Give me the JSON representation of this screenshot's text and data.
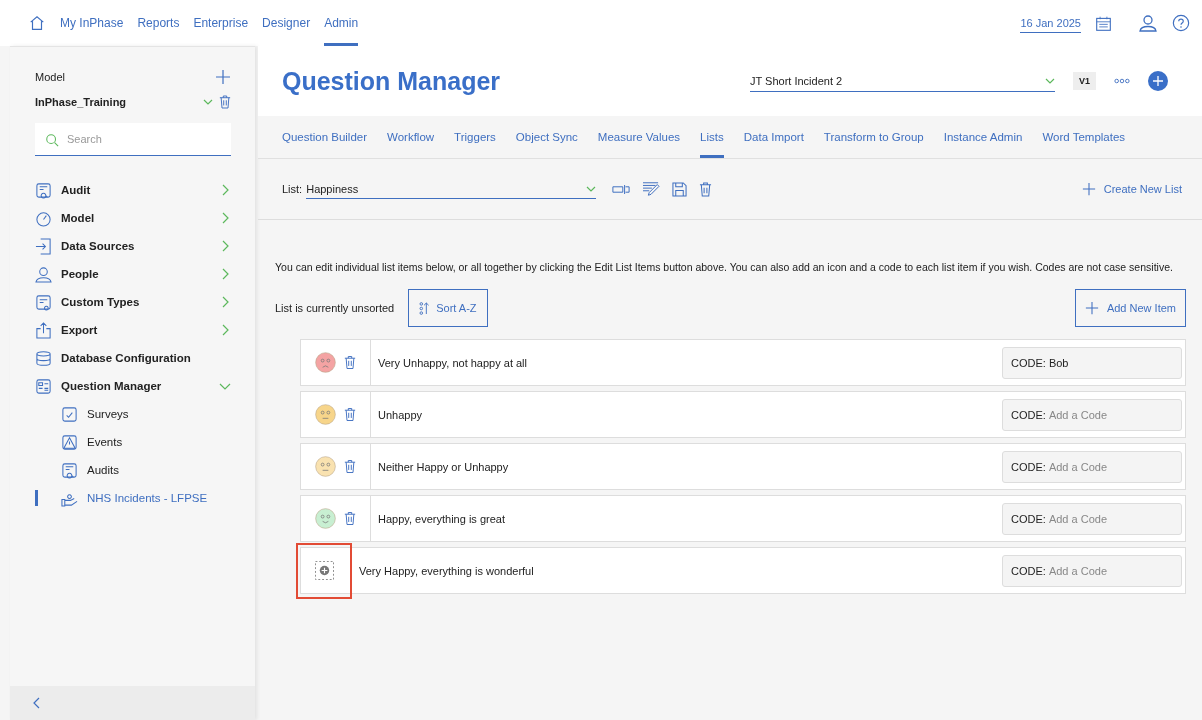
{
  "top_nav": {
    "items": [
      {
        "label": "My InPhase",
        "selected": false
      },
      {
        "label": "Reports",
        "selected": false
      },
      {
        "label": "Enterprise",
        "selected": false
      },
      {
        "label": "Designer",
        "selected": false
      },
      {
        "label": "Admin",
        "selected": true
      }
    ],
    "date": "16 Jan 2025"
  },
  "sidebar": {
    "model_label": "Model",
    "model_value": "InPhase_Training",
    "search": {
      "placeholder": "Search"
    },
    "items": [
      {
        "label": "Audit",
        "expanded": false
      },
      {
        "label": "Model",
        "expanded": false
      },
      {
        "label": "Data Sources",
        "expanded": false
      },
      {
        "label": "People",
        "expanded": false
      },
      {
        "label": "Custom Types",
        "expanded": false
      },
      {
        "label": "Export",
        "expanded": false
      },
      {
        "label": "Database Configuration"
      },
      {
        "label": "Question Manager",
        "expanded": true,
        "children": [
          {
            "label": "Surveys",
            "selected": false
          },
          {
            "label": "Events",
            "selected": false
          },
          {
            "label": "Audits",
            "selected": false
          },
          {
            "label": "NHS Incidents - LFPSE",
            "selected": true
          }
        ]
      }
    ]
  },
  "header": {
    "title": "Question Manager",
    "form_select": "JT Short Incident 2",
    "version": "V1"
  },
  "tabs": [
    {
      "label": "Question Builder",
      "selected": false
    },
    {
      "label": "Workflow",
      "selected": false
    },
    {
      "label": "Triggers",
      "selected": false
    },
    {
      "label": "Object Sync",
      "selected": false
    },
    {
      "label": "Measure Values",
      "selected": false
    },
    {
      "label": "Lists",
      "selected": true
    },
    {
      "label": "Data Import",
      "selected": false
    },
    {
      "label": "Transform to Group",
      "selected": false
    },
    {
      "label": "Instance Admin",
      "selected": false
    },
    {
      "label": "Word Templates",
      "selected": false
    }
  ],
  "list_toolbar": {
    "label": "List:",
    "value": "Happiness",
    "create_button": "Create New List"
  },
  "info_text": "You can edit individual list items below, or all together by clicking the Edit List Items button above. You can also add an icon and a code to each list item if you wish. Codes are not case sensitive.",
  "sort_status": "List is currently unsorted",
  "sort_button": "Sort A-Z",
  "add_button": "Add New Item",
  "list_items": [
    {
      "kind": "emoji",
      "color": "#f4a3a3",
      "text": "Very Unhappy, not happy at all",
      "code_label": "CODE:",
      "code_value": "Bob"
    },
    {
      "kind": "emoji",
      "color": "#f7d58a",
      "text": "Unhappy",
      "code_label": "CODE:",
      "code_placeholder": "Add a Code"
    },
    {
      "kind": "emoji",
      "color": "#f9e2b0",
      "text": "Neither Happy or Unhappy",
      "code_label": "CODE:",
      "code_placeholder": "Add a Code"
    },
    {
      "kind": "emoji",
      "color": "#c8efd2",
      "text": "Happy, everything is great",
      "code_label": "CODE:",
      "code_placeholder": "Add a Code"
    },
    {
      "kind": "add",
      "highlighted": true,
      "text": "Very Happy, everything is wonderful",
      "code_label": "CODE:",
      "code_placeholder": "Add a Code"
    }
  ]
}
